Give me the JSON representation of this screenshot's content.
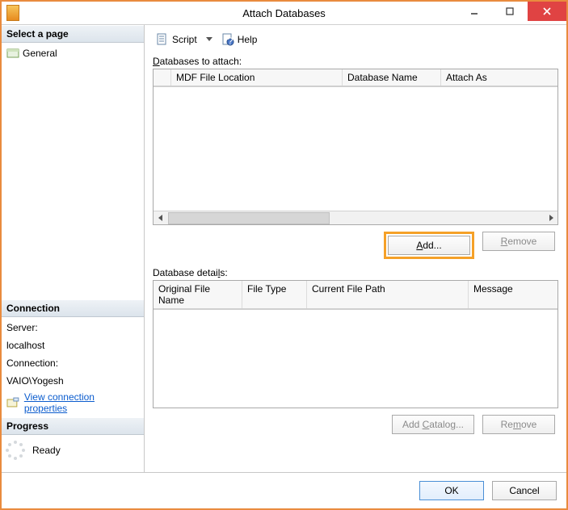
{
  "window": {
    "title": "Attach Databases"
  },
  "left": {
    "select_page_hdr": "Select a page",
    "page_general": "General",
    "connection_hdr": "Connection",
    "server_lbl": "Server:",
    "server_val": "localhost",
    "conn_lbl": "Connection:",
    "conn_val": "VAIO\\Yogesh",
    "view_props": "View connection properties",
    "progress_hdr": "Progress",
    "progress_status": "Ready"
  },
  "toolbar": {
    "script": "Script",
    "help": "Help"
  },
  "attach": {
    "label_pre": "D",
    "label_rest": "atabases to attach:",
    "col_mdf": "MDF File Location",
    "col_db": "Database Name",
    "col_as": "Attach As",
    "add_pre": "A",
    "add_rest": "dd...",
    "remove_pre": "R",
    "remove_rest": "emove"
  },
  "details": {
    "label_pre": "l",
    "label_start": "Database detai",
    "label_end": "s:",
    "col_orig": "Original File Name",
    "col_type": "File Type",
    "col_path": "Current File Path",
    "col_msg": "Message",
    "addcat_pre": "C",
    "addcat_start": "Add ",
    "addcat_end": "atalog...",
    "remove_pre": "m",
    "remove_start": "Re",
    "remove_end": "ove"
  },
  "footer": {
    "ok": "OK",
    "cancel": "Cancel"
  }
}
